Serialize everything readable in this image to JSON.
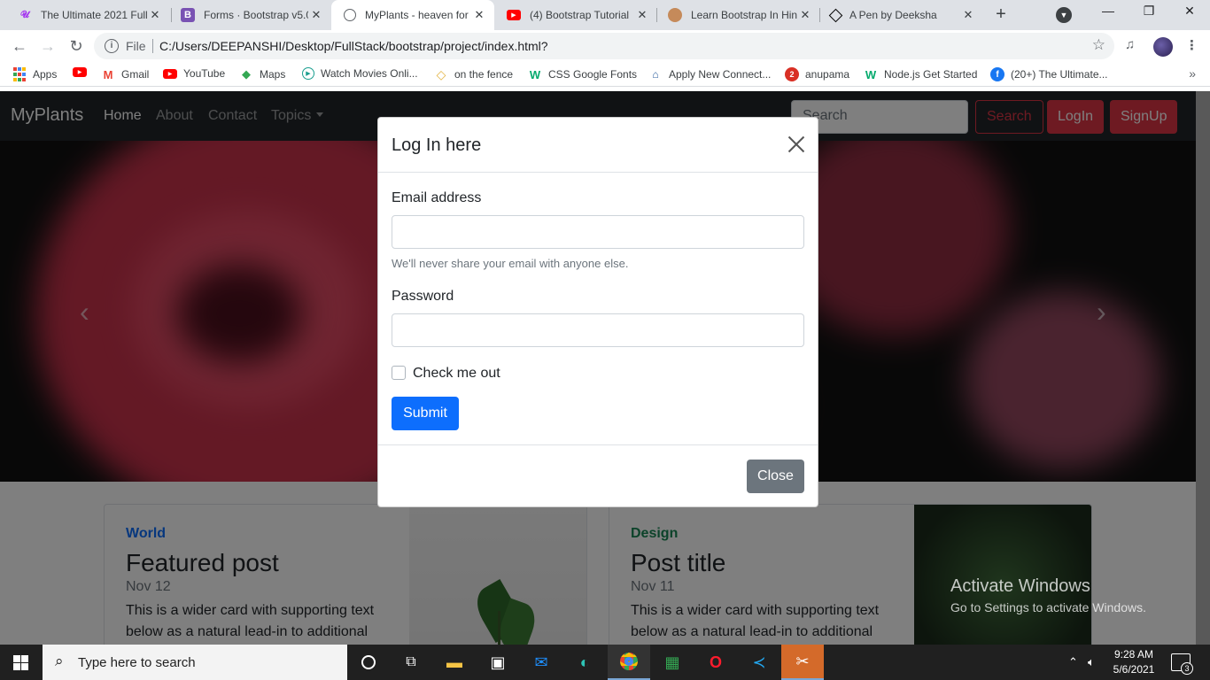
{
  "browser": {
    "tabs": [
      {
        "title": "The Ultimate 2021 Full",
        "icon": "udemy-icon",
        "color": "#a435f0"
      },
      {
        "title": "Forms · Bootstrap v5.0",
        "icon": "bootstrap-icon",
        "color": "#7952b3"
      },
      {
        "title": "MyPlants - heaven for",
        "icon": "globe-icon",
        "color": "#5f6368"
      },
      {
        "title": "(4) Bootstrap Tutorial",
        "icon": "youtube-icon",
        "color": "#ff0000"
      },
      {
        "title": "Learn Bootstrap In Hin",
        "icon": "avatar-icon",
        "color": "#c58a5a"
      },
      {
        "title": "A Pen by Deeksha",
        "icon": "codepen-icon",
        "color": "#000000"
      }
    ],
    "address": {
      "scheme": "File",
      "url": "C:/Users/DEEPANSHI/Desktop/FullStack/bootstrap/project/index.html?"
    },
    "bookmarks": [
      {
        "label": "Apps",
        "icon": "apps-grid-icon"
      },
      {
        "label": "",
        "icon": "youtube-icon"
      },
      {
        "label": "Gmail",
        "icon": "gmail-icon"
      },
      {
        "label": "YouTube",
        "icon": "youtube-icon"
      },
      {
        "label": "Maps",
        "icon": "maps-icon"
      },
      {
        "label": "Watch Movies Onli...",
        "icon": "play-icon"
      },
      {
        "label": "on the fence",
        "icon": "diamond-icon"
      },
      {
        "label": "CSS Google Fonts",
        "icon": "w3schools-icon"
      },
      {
        "label": "Apply New Connect...",
        "icon": "connection-icon"
      },
      {
        "label": "anupama",
        "icon": "number-icon"
      },
      {
        "label": "Node.js Get Started",
        "icon": "w3schools-icon"
      },
      {
        "label": "(20+) The Ultimate...",
        "icon": "facebook-icon"
      }
    ],
    "bookmarks_more": "»"
  },
  "site": {
    "brand": "MyPlants",
    "nav": [
      "Home",
      "About",
      "Contact",
      "Topics"
    ],
    "search_placeholder": "Search",
    "search_button": "Search",
    "login_button": "LogIn",
    "signup_button": "SignUp",
    "cards": [
      {
        "category": "World",
        "title": "Featured post",
        "date": "Nov 12",
        "text": "This is a wider card with supporting text below as a natural lead-in to additional",
        "category_color": "#0d6efd"
      },
      {
        "category": "Design",
        "title": "Post title",
        "date": "Nov 11",
        "text": "This is a wider card with supporting text below as a natural lead-in to additional",
        "category_color": "#198754"
      }
    ]
  },
  "modal": {
    "title": "Log In here",
    "email_label": "Email address",
    "email_help": "We'll never share your email with anyone else.",
    "password_label": "Password",
    "check_label": "Check me out",
    "submit": "Submit",
    "close": "Close"
  },
  "watermark": {
    "line1": "Activate Windows",
    "line2": "Go to Settings to activate Windows."
  },
  "taskbar": {
    "search_placeholder": "Type here to search",
    "time": "9:28 AM",
    "date": "5/6/2021",
    "notifications": "3"
  }
}
